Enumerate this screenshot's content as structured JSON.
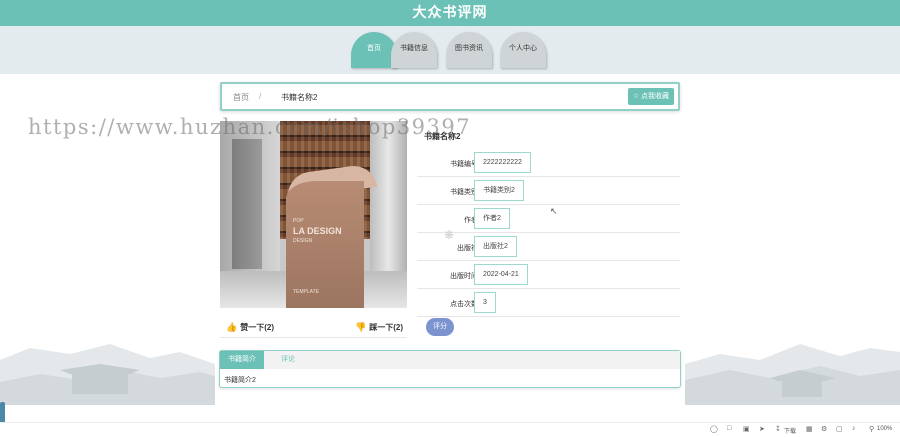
{
  "site": {
    "title": "大众书评网"
  },
  "nav": {
    "tabs": [
      {
        "label": "首页",
        "active": true
      },
      {
        "label": "书籍信息",
        "active": false
      },
      {
        "label": "图书资讯",
        "active": false
      },
      {
        "label": "个人中心",
        "active": false
      }
    ]
  },
  "breadcrumb": {
    "home": "首页",
    "separator": "/",
    "current": "书籍名称2",
    "favorite_button": "☆ 点我收藏"
  },
  "poster": {
    "main_text": "LA DESIGN",
    "small_lines": [
      "POP",
      "LA DESIGN",
      "DESIGN"
    ],
    "footer": "TEMPLATE"
  },
  "votes": {
    "like_label": "赞一下(2)",
    "dislike_label": "踩一下(2)"
  },
  "book": {
    "title": "书籍名称2",
    "fields": [
      {
        "label": "书籍编号:",
        "value": "2222222222"
      },
      {
        "label": "书籍类别:",
        "value": "书籍类别2"
      },
      {
        "label": "作者:",
        "value": "作者2"
      },
      {
        "label": "出版社:",
        "value": "出版社2"
      },
      {
        "label": "出版时间:",
        "value": "2022-04-21"
      },
      {
        "label": "点击次数:",
        "value": "3"
      }
    ],
    "rate_button": "评分"
  },
  "detail_tabs": {
    "tabs": [
      {
        "label": "书籍简介",
        "active": true
      },
      {
        "label": "评论",
        "active": false
      }
    ],
    "content": "书籍简介2"
  },
  "watermark": "https://www.huzhan.com/ishop39397",
  "statusbar": {
    "download_label": "下载",
    "zoom": "100%"
  },
  "colors": {
    "accent": "#6cc1b7",
    "nav_bg": "#e3ebef",
    "rate_button": "#7b93cf",
    "vote_icon": "#e0453a"
  }
}
